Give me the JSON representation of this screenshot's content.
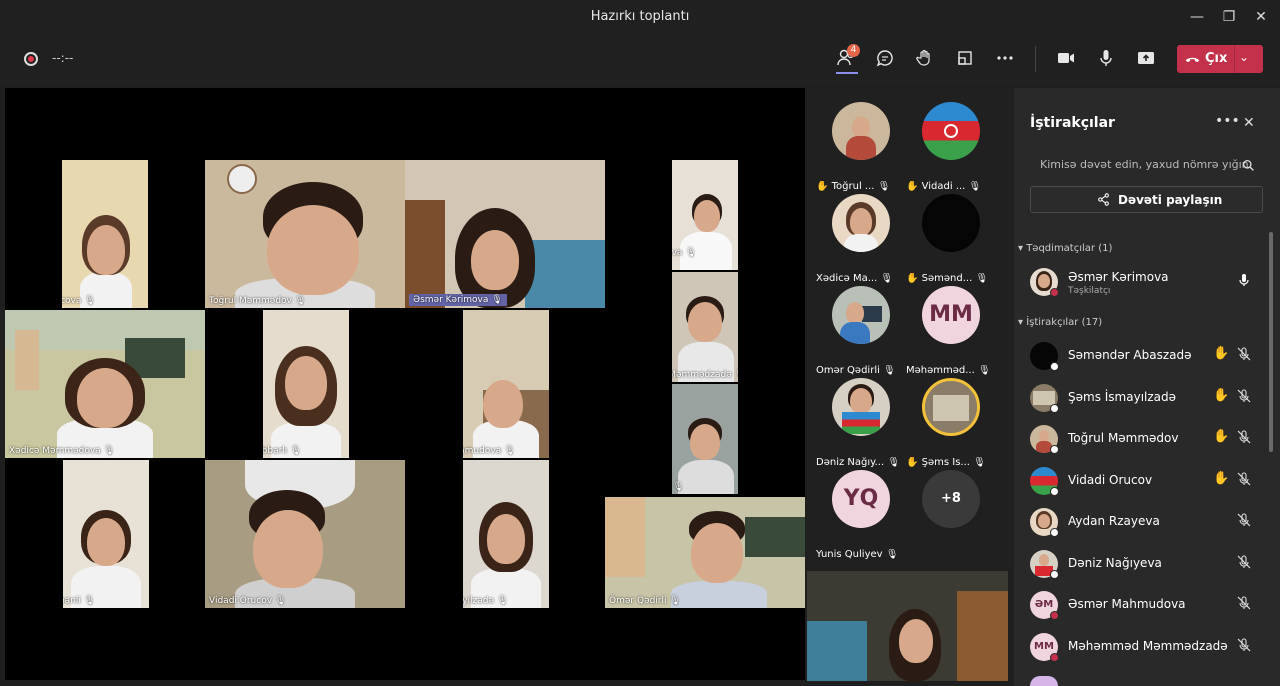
{
  "window": {
    "title": "Hazırkı toplantı",
    "minimize": "—",
    "restore": "❐",
    "close": "✕"
  },
  "toolbar": {
    "timer": "--:--",
    "participants_badge": "4",
    "leave_label": "Çıx"
  },
  "stage": {
    "tiles": [
      {
        "name": "Nərgiz Orucova"
      },
      {
        "name": "Toğrul Məmmədov"
      },
      {
        "name": "Əsmər Kərimova"
      },
      {
        "name": "Dəniz Nağıyeva"
      },
      {
        "name": "Xədicə Məmmədova"
      },
      {
        "name": "Zeynəb Cabbarlı"
      },
      {
        "name": "Əsmər Mahmudova"
      },
      {
        "name": "Məhəmməd Məmmədzadə"
      },
      {
        "name": "Yunis Quliyev"
      },
      {
        "name": "Zəhra Qurbanli"
      },
      {
        "name": "Vidadi Orucov"
      },
      {
        "name": "Şəms İsmayılzadə"
      },
      {
        "name": "Ömər Qədirli"
      }
    ]
  },
  "gallery": {
    "items": [
      {
        "name": "Toğrul ...",
        "initials": ""
      },
      {
        "name": "Vidadi ...",
        "initials": ""
      },
      {
        "name": "Xədicə Ma...",
        "initials": ""
      },
      {
        "name": "Səmənd...",
        "initials": ""
      },
      {
        "name": "Ömər Qədirli",
        "initials": ""
      },
      {
        "name": "Məhəmməd...",
        "initials": "MM"
      },
      {
        "name": "Dəniz Nağıy...",
        "initials": ""
      },
      {
        "name": "Şəms İs...",
        "initials": ""
      },
      {
        "name": "Yunis Quliyev",
        "initials": "YQ"
      },
      {
        "name": "",
        "initials": "+8"
      }
    ]
  },
  "panel": {
    "title": "İştirakçılar",
    "search_placeholder": "Kimisə dəvət edin, yaxud nömrə yığın",
    "share_label": "Dəvəti paylaşın",
    "presenters_header": "Təqdimatçılar (1)",
    "attendees_header": "İştirakçılar (17)",
    "presenter": {
      "name": "Əsmər Kərimova",
      "role": "Təşkilatçı"
    },
    "attendees": [
      {
        "name": "Səməndər Abaszadə",
        "hand": true,
        "initials": ""
      },
      {
        "name": "Şəms İsmayılzadə",
        "hand": true,
        "initials": ""
      },
      {
        "name": "Toğrul Məmmədov",
        "hand": true,
        "initials": ""
      },
      {
        "name": "Vidadi Orucov",
        "hand": true,
        "initials": ""
      },
      {
        "name": "Aydan Rzayeva",
        "hand": false,
        "initials": ""
      },
      {
        "name": "Dəniz Nağıyeva",
        "hand": false,
        "initials": ""
      },
      {
        "name": "Əsmər Mahmudova",
        "hand": false,
        "initials": "ƏM"
      },
      {
        "name": "Məhəmməd Məmmədzadə",
        "hand": false,
        "initials": "MM"
      }
    ]
  },
  "colors": {
    "accent": "#6264a7",
    "leave": "#c4314b",
    "hand": "#f3c13a",
    "avatar_bg": "#f0d5df"
  },
  "icons": [
    "people-icon",
    "chat-icon",
    "raise-hand-icon",
    "rooms-icon",
    "more-icon",
    "camera-icon",
    "mic-icon",
    "share-screen-icon",
    "phone-hangup-icon"
  ]
}
